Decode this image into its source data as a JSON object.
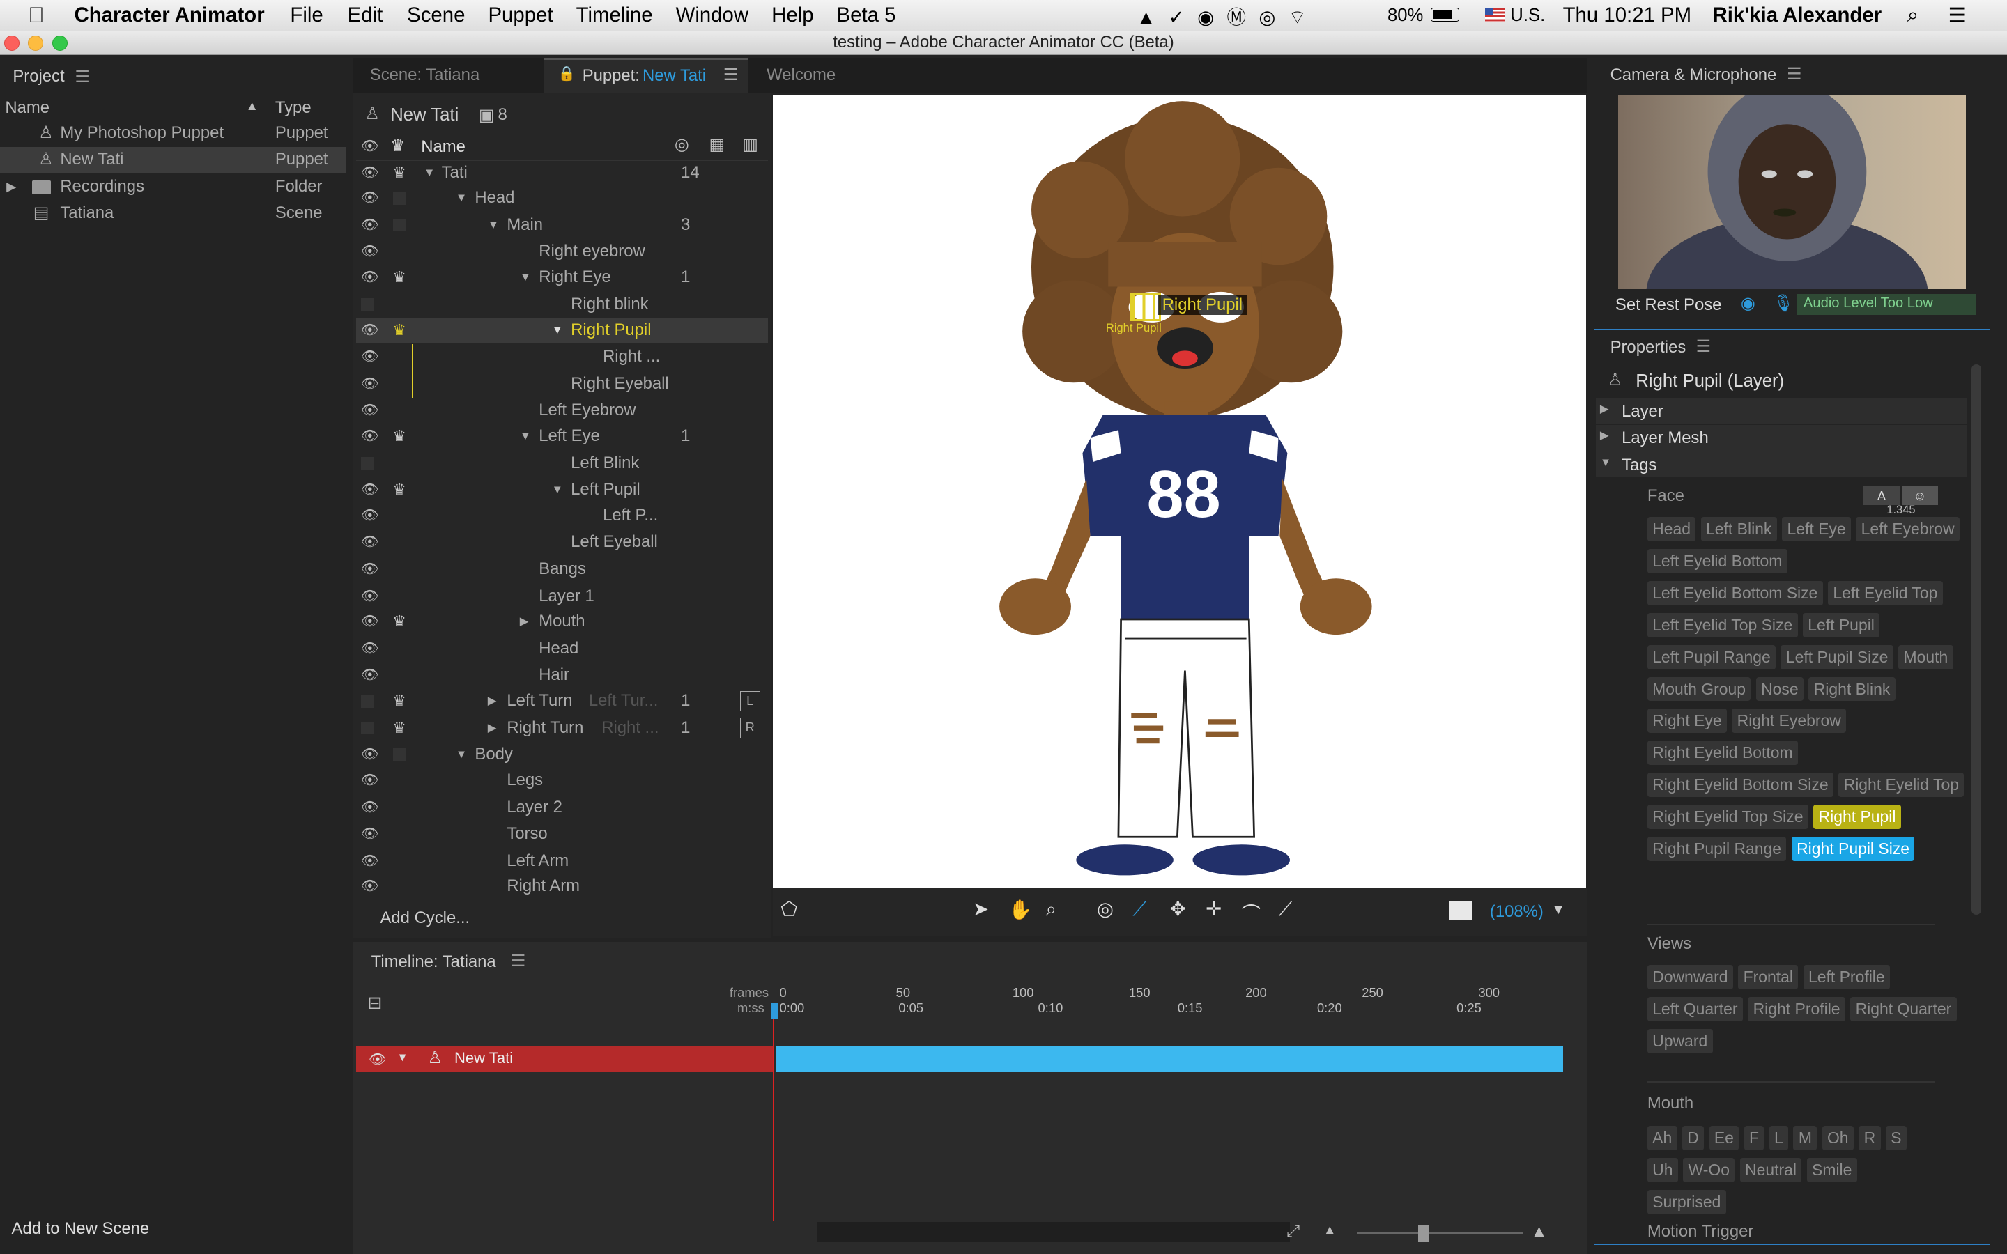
{
  "menubar": {
    "app": "Character Animator",
    "items": [
      "File",
      "Edit",
      "Scene",
      "Puppet",
      "Timeline",
      "Window",
      "Help",
      "Beta 5"
    ],
    "battery": "80%",
    "input": "U.S.",
    "clock": "Thu 10:21 PM",
    "user": "Rik'kia Alexander"
  },
  "window_title": "testing – Adobe Character Animator CC (Beta)",
  "project": {
    "title": "Project",
    "col_name": "Name",
    "col_type": "Type",
    "items": [
      {
        "name": "My Photoshop Puppet",
        "type": "Puppet"
      },
      {
        "name": "New Tati",
        "type": "Puppet"
      },
      {
        "name": "Recordings",
        "type": "Folder"
      },
      {
        "name": "Tatiana",
        "type": "Scene"
      }
    ],
    "bottom": "Add to New Scene"
  },
  "tabs": [
    "Scene: Tatiana",
    "Puppet:",
    "New Tati",
    "Welcome"
  ],
  "puppet": {
    "name": "New Tati",
    "count": "8",
    "col_name": "Name",
    "add_cycle": "Add Cycle...",
    "rows": [
      {
        "n": "Tati",
        "v": "14"
      },
      {
        "n": "Head",
        "v": ""
      },
      {
        "n": "Main",
        "v": "3"
      },
      {
        "n": "Right eyebrow",
        "v": ""
      },
      {
        "n": "Right Eye",
        "v": "1"
      },
      {
        "n": "Right blink",
        "v": ""
      },
      {
        "n": "Right Pupil",
        "v": ""
      },
      {
        "n": "Right ...",
        "v": ""
      },
      {
        "n": "Right Eyeball",
        "v": ""
      },
      {
        "n": "Left Eyebrow",
        "v": ""
      },
      {
        "n": "Left Eye",
        "v": "1"
      },
      {
        "n": "Left Blink",
        "v": ""
      },
      {
        "n": "Left Pupil",
        "v": ""
      },
      {
        "n": "Left P...",
        "v": ""
      },
      {
        "n": "Left Eyeball",
        "v": ""
      },
      {
        "n": "Bangs",
        "v": ""
      },
      {
        "n": "Layer 1",
        "v": ""
      },
      {
        "n": "Mouth",
        "v": ""
      },
      {
        "n": "Head",
        "v": ""
      },
      {
        "n": "Hair",
        "v": ""
      },
      {
        "n": "Left Turn",
        "v": "1",
        "x": "Left Tur...",
        "k": "L"
      },
      {
        "n": "Right Turn",
        "v": "1",
        "x": "Right ...",
        "k": "R"
      },
      {
        "n": "Body",
        "v": ""
      },
      {
        "n": "Legs",
        "v": ""
      },
      {
        "n": "Layer 2",
        "v": ""
      },
      {
        "n": "Torso",
        "v": ""
      },
      {
        "n": "Left Arm",
        "v": ""
      },
      {
        "n": "Right Arm",
        "v": ""
      }
    ]
  },
  "canvas": {
    "label_big": "Right Pupil",
    "label_small": "Right Pupil",
    "jersey": "88",
    "zoom": "(108%)"
  },
  "camera": {
    "title": "Camera & Microphone",
    "rest": "Set Rest Pose",
    "audio": "Audio Level Too Low"
  },
  "props": {
    "title": "Properties",
    "layer": "Right Pupil (Layer)",
    "sections": [
      "Layer",
      "Layer Mesh",
      "Tags"
    ],
    "face": "Face",
    "a": "A",
    "num": "1.345",
    "tags": [
      "Head",
      "Left Blink",
      "Left Eye",
      "Left Eyebrow",
      "Left Eyelid Bottom",
      "Left Eyelid Bottom Size",
      "Left Eyelid Top",
      "Left Eyelid Top Size",
      "Left Pupil",
      "Left Pupil Range",
      "Left Pupil Size",
      "Mouth",
      "Mouth Group",
      "Nose",
      "Right Blink",
      "Right Eye",
      "Right Eyebrow",
      "Right Eyelid Bottom",
      "Right Eyelid Bottom Size",
      "Right Eyelid Top",
      "Right Eyelid Top Size",
      "Right Pupil",
      "Right Pupil Range",
      "Right Pupil Size"
    ],
    "views": "Views",
    "view_tags": [
      "Downward",
      "Frontal",
      "Left Profile",
      "Left Quarter",
      "Right Profile",
      "Right Quarter",
      "Upward"
    ],
    "mouth": "Mouth",
    "mouth_tags": [
      "Ah",
      "D",
      "Ee",
      "F",
      "L",
      "M",
      "Oh",
      "R",
      "S",
      "Uh",
      "W-Oo",
      "Neutral",
      "Smile",
      "Surprised"
    ],
    "motion": "Motion Trigger"
  },
  "timeline": {
    "title": "Timeline: Tatiana",
    "frames": "frames",
    "mss": "m:ss",
    "fticks": [
      "0",
      "50",
      "100",
      "150",
      "200",
      "250",
      "300"
    ],
    "tticks": [
      "0:00",
      "0:05",
      "0:10",
      "0:15",
      "0:20",
      "0:25"
    ],
    "track": "New Tati"
  }
}
